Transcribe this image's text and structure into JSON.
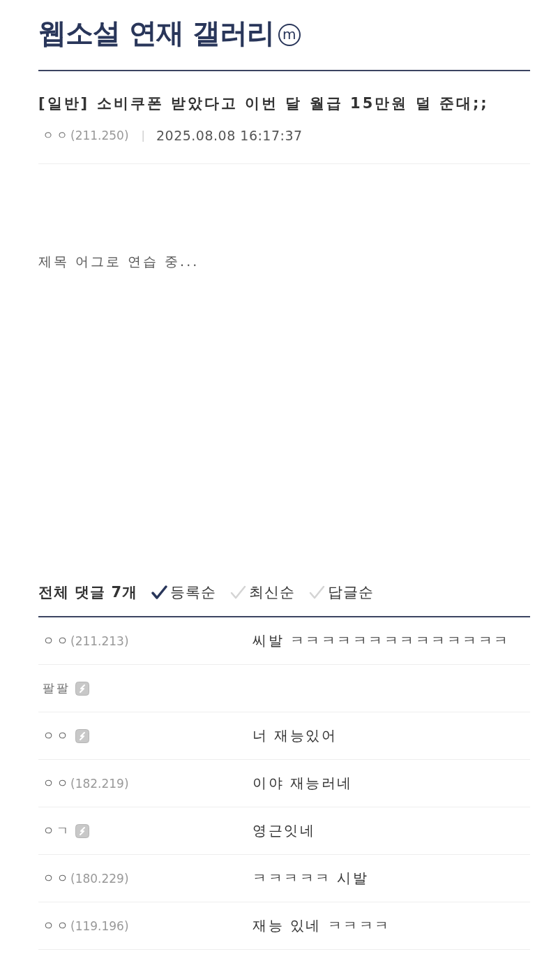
{
  "gallery": {
    "title": "웹소설 연재 갤러리",
    "badge": "m"
  },
  "post": {
    "title": "[일반] 소비쿠폰 받았다고 이번 달 월급 15만원 덜 준대;;",
    "author": "ㅇㅇ",
    "ip": "(211.250)",
    "separator": "|",
    "date": "2025.08.08 16:17:37",
    "body": "제목 어그로 연습 중..."
  },
  "comments": {
    "count_label": "전체 댓글 7개",
    "sort_options": [
      {
        "label": "등록순",
        "selected": true
      },
      {
        "label": "최신순",
        "selected": false
      },
      {
        "label": "답글순",
        "selected": false
      }
    ],
    "rows": [
      {
        "nickname": "ㅇㅇ",
        "ip": "(211.213)",
        "member": false,
        "text": "씨발 ㅋㅋㅋㅋㅋㅋㅋㅋㅋㅋㅋㅋㅋㅋ"
      },
      {
        "nickname": "팔팔",
        "member": true
      },
      {
        "nickname": "ㅇㅇ",
        "member": true,
        "text": "너 재능있어"
      },
      {
        "nickname": "ㅇㅇ",
        "ip": "(182.219)",
        "member": false,
        "text": "이야 재능러네"
      },
      {
        "nickname": "ㅇㄱ",
        "member": true,
        "text": "영근잇네"
      },
      {
        "nickname": "ㅇㅇ",
        "ip": "(180.229)",
        "member": false,
        "text": "ㅋㅋㅋㅋㅋ 시발"
      },
      {
        "nickname": "ㅇㅇ",
        "ip": "(119.196)",
        "member": false,
        "text": "재능 있네 ㅋㅋㅋㅋ"
      }
    ]
  }
}
